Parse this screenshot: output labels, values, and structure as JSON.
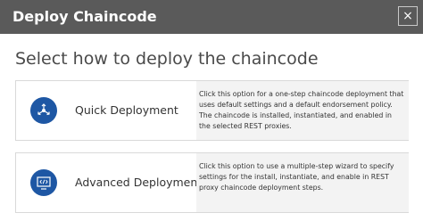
{
  "dialog": {
    "title": "Deploy Chaincode",
    "close_label": "×",
    "heading": "Select how to deploy the chaincode"
  },
  "options": [
    {
      "label": "Quick Deployment",
      "icon": "deploy-network-icon",
      "description": "Click this option for a one-step chaincode deployment that uses default settings and a default endorsement policy. The chaincode is installed, instantiated, and enabled in the selected REST proxies."
    },
    {
      "label": "Advanced Deployment",
      "icon": "code-monitor-icon",
      "description": "Click this option to use a multiple-step wizard to specify settings for the install, instantiate, and enable in REST proxy chaincode deployment steps."
    }
  ],
  "colors": {
    "titlebar": "#5a5a5a",
    "icon_background": "#1e57a4",
    "description_background": "#f3f3f3"
  }
}
